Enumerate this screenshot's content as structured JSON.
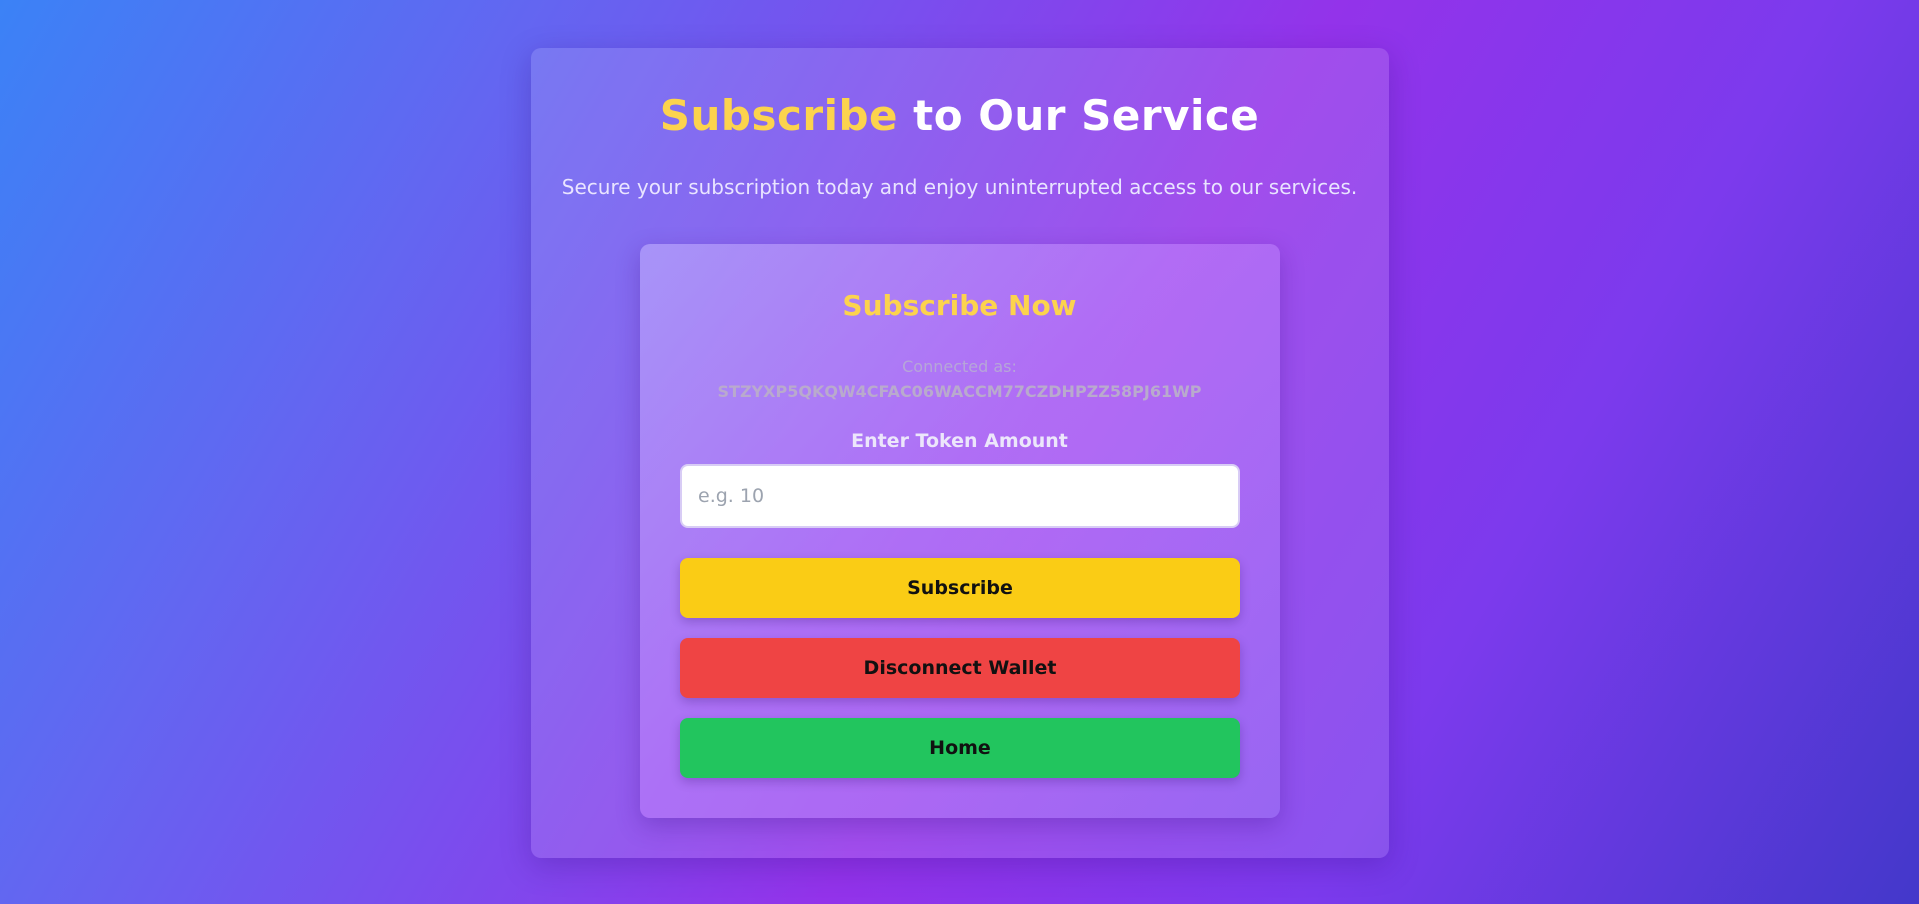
{
  "header": {
    "title_accent": "Subscribe",
    "title_rest": " to Our Service",
    "subtitle": "Secure your subscription today and enjoy uninterrupted access to our services."
  },
  "form": {
    "title": "Subscribe Now",
    "connected_label": "Connected as:",
    "connected_address": "STZYXP5QKQW4CFAC06WACCM77CZDHPZZ58PJ61WP",
    "token_label": "Enter Token Amount",
    "token_placeholder": "e.g. 10",
    "token_value": ""
  },
  "buttons": {
    "subscribe": "Subscribe",
    "disconnect": "Disconnect Wallet",
    "home": "Home"
  },
  "colors": {
    "accent": "#fcd34d",
    "subscribe_button": "#facc15",
    "disconnect_button": "#ef4444",
    "home_button": "#22c55e"
  }
}
